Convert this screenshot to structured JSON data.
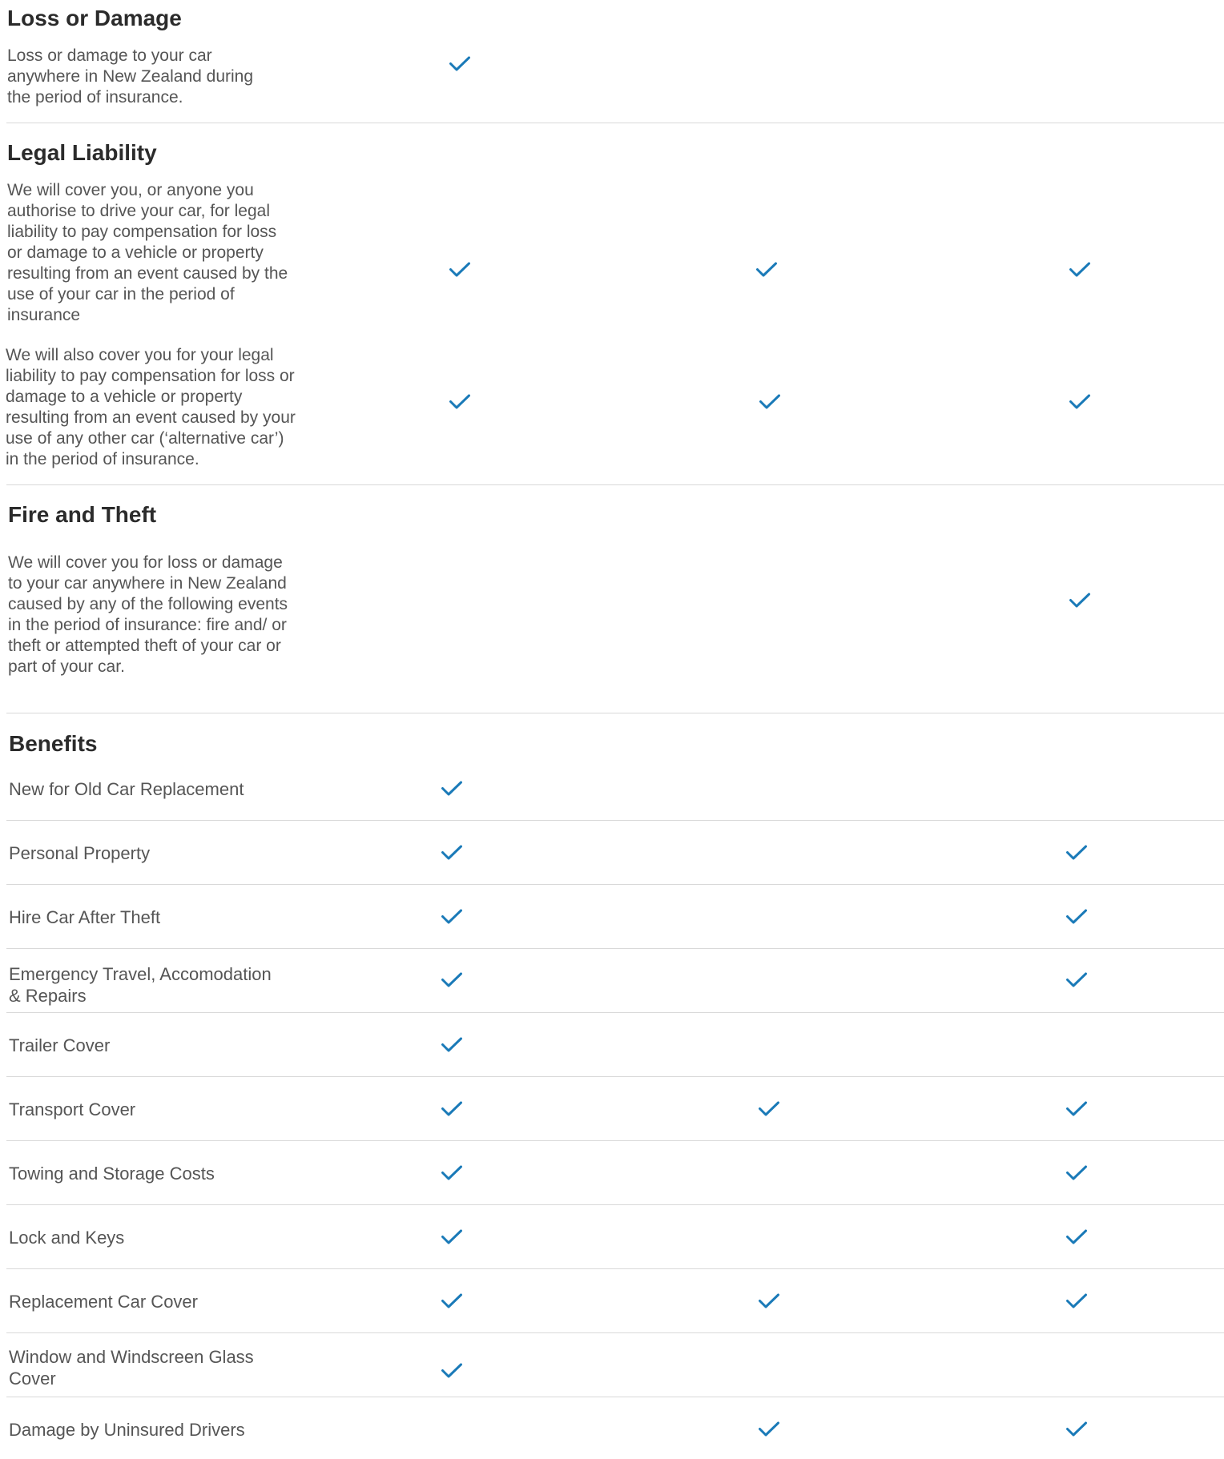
{
  "sections": {
    "loss_or_damage": {
      "title": "Loss or Damage",
      "desc": "Loss or damage to your car anywhere in New Zealand during the period of insurance."
    },
    "legal_liability": {
      "title": "Legal Liability",
      "desc1": "We will cover you, or anyone you authorise to drive your car, for legal liability to pay compensation for loss or damage to a vehicle or property resulting from an event caused by the use of your car in the period of insurance",
      "desc2": "We will also cover you for your legal liability to pay compensation for loss or damage to a vehicle or property resulting from an event caused by your use of any other car (‘alternative car’) in the period of insurance."
    },
    "fire_and_theft": {
      "title": "Fire and Theft",
      "desc": "We will cover you for loss or damage to your car anywhere in New Zealand caused by any of the following events in the period of insurance: fire and/ or theft or attempted theft of your car or part of your car."
    },
    "benefits": {
      "title": "Benefits",
      "items": [
        "New for Old Car Replacement",
        "Personal Property",
        "Hire Car After Theft",
        "Emergency Travel, Accomodation & Repairs",
        "Trailer Cover",
        "Transport Cover",
        "Towing and Storage Costs",
        "Lock and Keys",
        "Replacement Car Cover",
        "Window and Windscreen Glass Cover",
        "Damage by Uninsured Drivers"
      ]
    }
  },
  "coverage": {
    "loss_or_damage": [
      true,
      false,
      false
    ],
    "legal_liability_own_car": [
      true,
      true,
      true
    ],
    "legal_liability_alternative_car": [
      true,
      true,
      true
    ],
    "fire_and_theft": [
      false,
      false,
      true
    ],
    "new_for_old": [
      true,
      false,
      false
    ],
    "personal_property": [
      true,
      false,
      true
    ],
    "hire_car_after_theft": [
      true,
      false,
      true
    ],
    "emergency_travel": [
      true,
      false,
      true
    ],
    "trailer_cover": [
      true,
      false,
      false
    ],
    "transport_cover": [
      true,
      true,
      true
    ],
    "towing_storage": [
      true,
      false,
      true
    ],
    "lock_keys": [
      true,
      false,
      true
    ],
    "replacement_car": [
      true,
      true,
      true
    ],
    "window_glass": [
      true,
      false,
      false
    ],
    "uninsured_drivers": [
      false,
      true,
      true
    ]
  },
  "icons": {
    "check": "check-icon"
  },
  "colors": {
    "check": "#1a7ab8",
    "divider": "#d9d9d9",
    "heading": "#2b2b2b",
    "body_text": "#555555"
  }
}
